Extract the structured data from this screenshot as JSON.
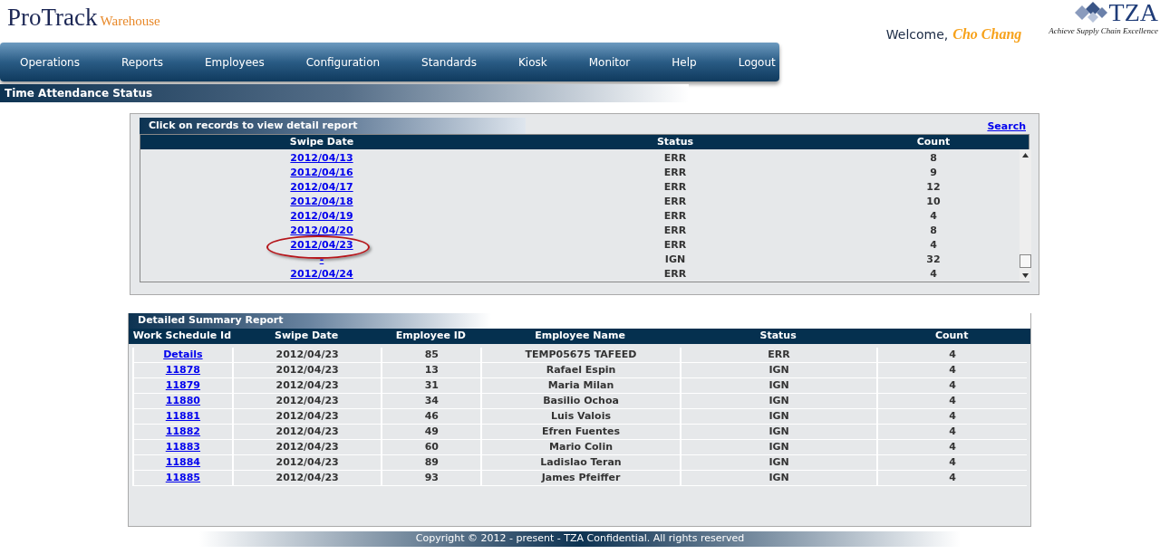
{
  "header": {
    "logo_main": "ProTrack",
    "logo_sub": "Warehouse",
    "welcome": "Welcome,",
    "user": "Cho Chang",
    "brand": "TZA",
    "tagline": "Achieve Supply Chain Excellence"
  },
  "nav": [
    "Operations",
    "Reports",
    "Employees",
    "Configuration",
    "Standards",
    "Kiosk",
    "Monitor",
    "Help",
    "Logout"
  ],
  "page_title": "Time Attendance Status",
  "records": {
    "title": "Click on records to view detail report",
    "search": "Search",
    "columns": [
      "Swipe Date",
      "Status",
      "Count"
    ],
    "rows": [
      {
        "date": "2012/04/13",
        "status": "ERR",
        "count": "8",
        "circled": false
      },
      {
        "date": "2012/04/16",
        "status": "ERR",
        "count": "9",
        "circled": false
      },
      {
        "date": "2012/04/17",
        "status": "ERR",
        "count": "12",
        "circled": false
      },
      {
        "date": "2012/04/18",
        "status": "ERR",
        "count": "10",
        "circled": false
      },
      {
        "date": "2012/04/19",
        "status": "ERR",
        "count": "4",
        "circled": false
      },
      {
        "date": "2012/04/20",
        "status": "ERR",
        "count": "8",
        "circled": false
      },
      {
        "date": "2012/04/23",
        "status": "ERR",
        "count": "4",
        "circled": true
      },
      {
        "date": "-",
        "status": "IGN",
        "count": "32",
        "circled": false
      },
      {
        "date": "2012/04/24",
        "status": "ERR",
        "count": "4",
        "circled": false
      }
    ]
  },
  "summary": {
    "title": "Detailed Summary Report",
    "columns": [
      "Work Schedule Id",
      "Swipe Date",
      "Employee ID",
      "Employee Name",
      "Status",
      "Count"
    ],
    "rows": [
      [
        "Details",
        "2012/04/23",
        "85",
        "TEMP05675 TAFEED",
        "ERR",
        "4"
      ],
      [
        "11878",
        "2012/04/23",
        "13",
        "Rafael Espin",
        "IGN",
        "4"
      ],
      [
        "11879",
        "2012/04/23",
        "31",
        "Maria Milan",
        "IGN",
        "4"
      ],
      [
        "11880",
        "2012/04/23",
        "34",
        "Basilio Ochoa",
        "IGN",
        "4"
      ],
      [
        "11881",
        "2012/04/23",
        "46",
        "Luis Valois",
        "IGN",
        "4"
      ],
      [
        "11882",
        "2012/04/23",
        "49",
        "Efren Fuentes",
        "IGN",
        "4"
      ],
      [
        "11883",
        "2012/04/23",
        "60",
        "Mario Colin",
        "IGN",
        "4"
      ],
      [
        "11884",
        "2012/04/23",
        "89",
        "Ladislao Teran",
        "IGN",
        "4"
      ],
      [
        "11885",
        "2012/04/23",
        "93",
        "James Pfeiffer",
        "IGN",
        "4"
      ]
    ]
  },
  "footer": "Copyright © 2012 - present - TZA Confidential. All rights reserved"
}
